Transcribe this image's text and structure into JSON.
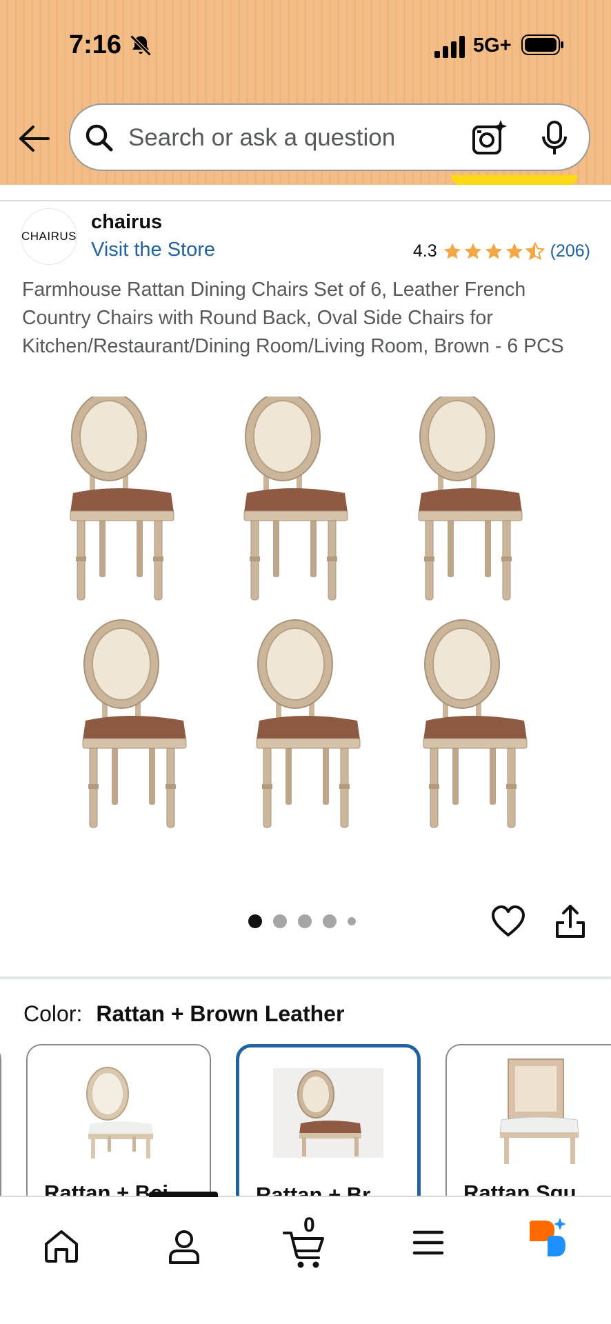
{
  "status_bar": {
    "time": "7:16",
    "network": "5G+"
  },
  "search": {
    "placeholder": "Search or ask a question"
  },
  "brand": {
    "logo_text": "CHAIRUS",
    "name": "chairus",
    "store_link": "Visit the Store"
  },
  "rating": {
    "value": "4.3",
    "stars": 4.3,
    "count": "(206)"
  },
  "product": {
    "title": "Farmhouse Rattan Dining Chairs Set of 6, Leather French Country Chairs with Round Back, Oval Side Chairs for Kitchen/Restaurant/Dining Room/Living Room, Brown - 6 PCS"
  },
  "image_gallery": {
    "total_dots": 5,
    "active_index": 0
  },
  "color": {
    "label": "Color:",
    "selected": "Rattan + Brown Leather",
    "options": [
      {
        "label": "Rattan + Bei",
        "selected": false
      },
      {
        "label": "Rattan + Br",
        "selected": true
      },
      {
        "label": "Rattan Squ",
        "selected": false
      }
    ]
  },
  "bottom_nav": {
    "cart_count": "0"
  },
  "colors": {
    "header_bg": "#f3bd87",
    "link": "#2162a1",
    "star": "#f3a847",
    "selected_border": "#2162a1",
    "chair_wood": "#cbb59b",
    "chair_cane": "#efe6d6",
    "chair_leather": "#8e5a44",
    "assistant_orange": "#ff6a00",
    "assistant_blue": "#1e90ff"
  }
}
